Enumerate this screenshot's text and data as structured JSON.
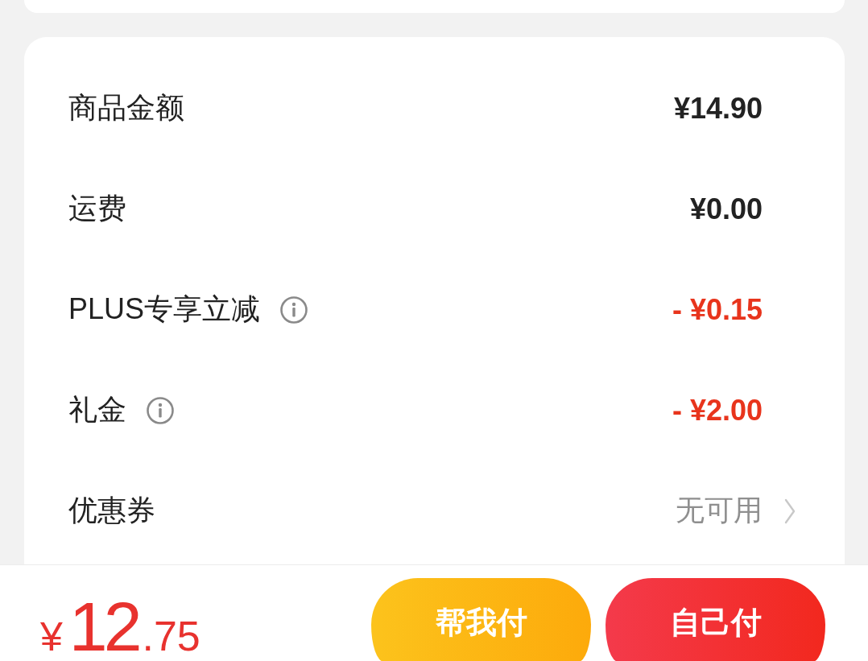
{
  "fee_rows": [
    {
      "label": "商品金额",
      "info": false,
      "value": "¥14.90",
      "kind": "amount"
    },
    {
      "label": "运费",
      "info": false,
      "value": "¥0.00",
      "kind": "amount"
    },
    {
      "label": "PLUS专享立减",
      "info": true,
      "value": "- ¥0.15",
      "kind": "discount"
    },
    {
      "label": "礼金",
      "info": true,
      "value": "- ¥2.00",
      "kind": "discount"
    },
    {
      "label": "优惠券",
      "info": false,
      "value": "无可用",
      "kind": "option"
    }
  ],
  "footer": {
    "total": {
      "currency": "¥",
      "integer": "12",
      "decimal": ".75"
    },
    "buttons": [
      {
        "label": "帮我付",
        "kind": "secondary"
      },
      {
        "label": "自己付",
        "kind": "primary"
      }
    ]
  }
}
